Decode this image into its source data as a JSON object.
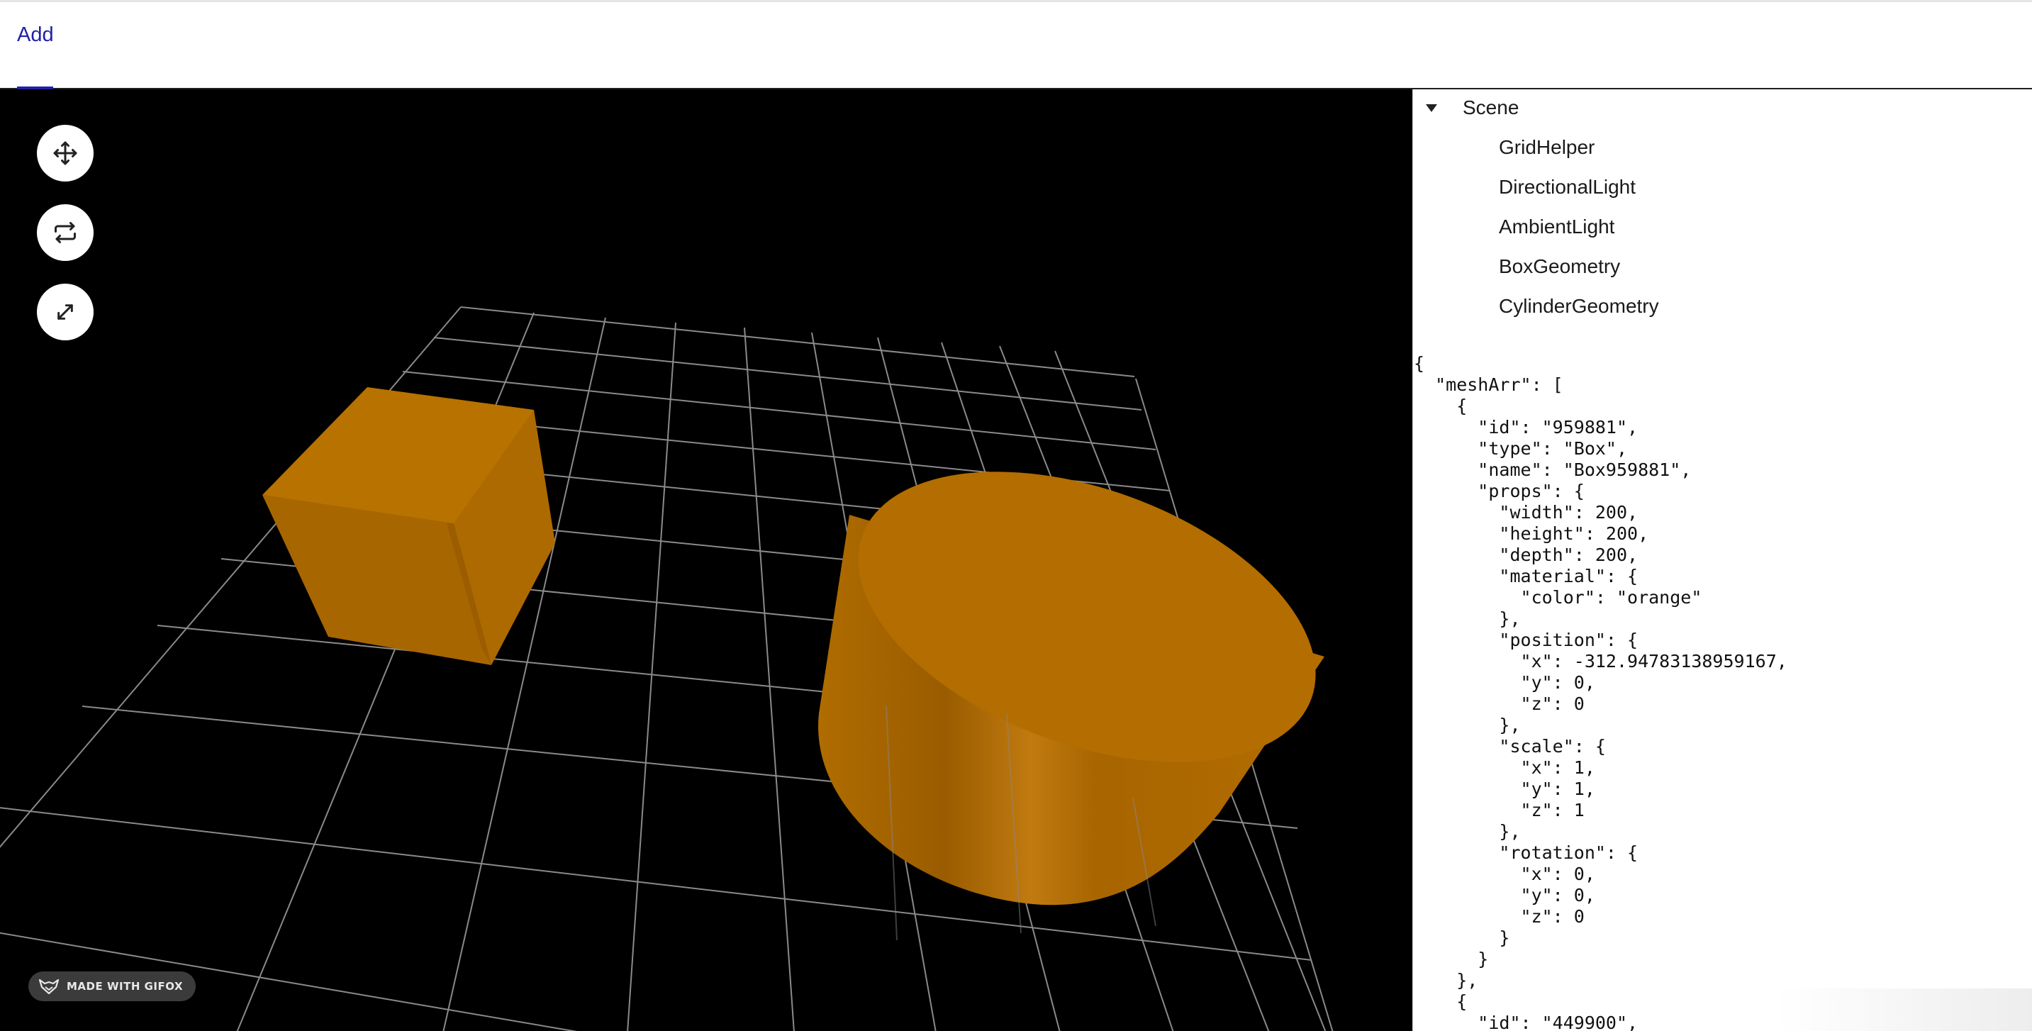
{
  "menubar": {
    "add_label": "Add"
  },
  "toolbar": {
    "translate_icon": "move-arrows-icon",
    "rotate_icon": "rotate-arrows-icon",
    "scale_icon": "expand-arrows-icon"
  },
  "scene_tree": {
    "root_label": "Scene",
    "children": [
      "GridHelper",
      "DirectionalLight",
      "AmbientLight",
      "BoxGeometry",
      "CylinderGeometry"
    ]
  },
  "json_lines": [
    "{",
    "  \"meshArr\": [",
    "    {",
    "      \"id\": \"959881\",",
    "      \"type\": \"Box\",",
    "      \"name\": \"Box959881\",",
    "      \"props\": {",
    "        \"width\": 200,",
    "        \"height\": 200,",
    "        \"depth\": 200,",
    "        \"material\": {",
    "          \"color\": \"orange\"",
    "        },",
    "        \"position\": {",
    "          \"x\": -312.94783138959167,",
    "          \"y\": 0,",
    "          \"z\": 0",
    "        },",
    "        \"scale\": {",
    "          \"x\": 1,",
    "          \"y\": 1,",
    "          \"z\": 1",
    "        },",
    "        \"rotation\": {",
    "          \"x\": 0,",
    "          \"y\": 0,",
    "          \"z\": 0",
    "        }",
    "      }",
    "    },",
    "    {",
    "      \"id\": \"449900\","
  ],
  "watermark": {
    "label": "MADE WITH GIFOX"
  },
  "colors": {
    "mesh": "#b36d00",
    "grid": "#8a8a8a",
    "accent": "#2121a8",
    "viewport_bg": "#000000"
  }
}
